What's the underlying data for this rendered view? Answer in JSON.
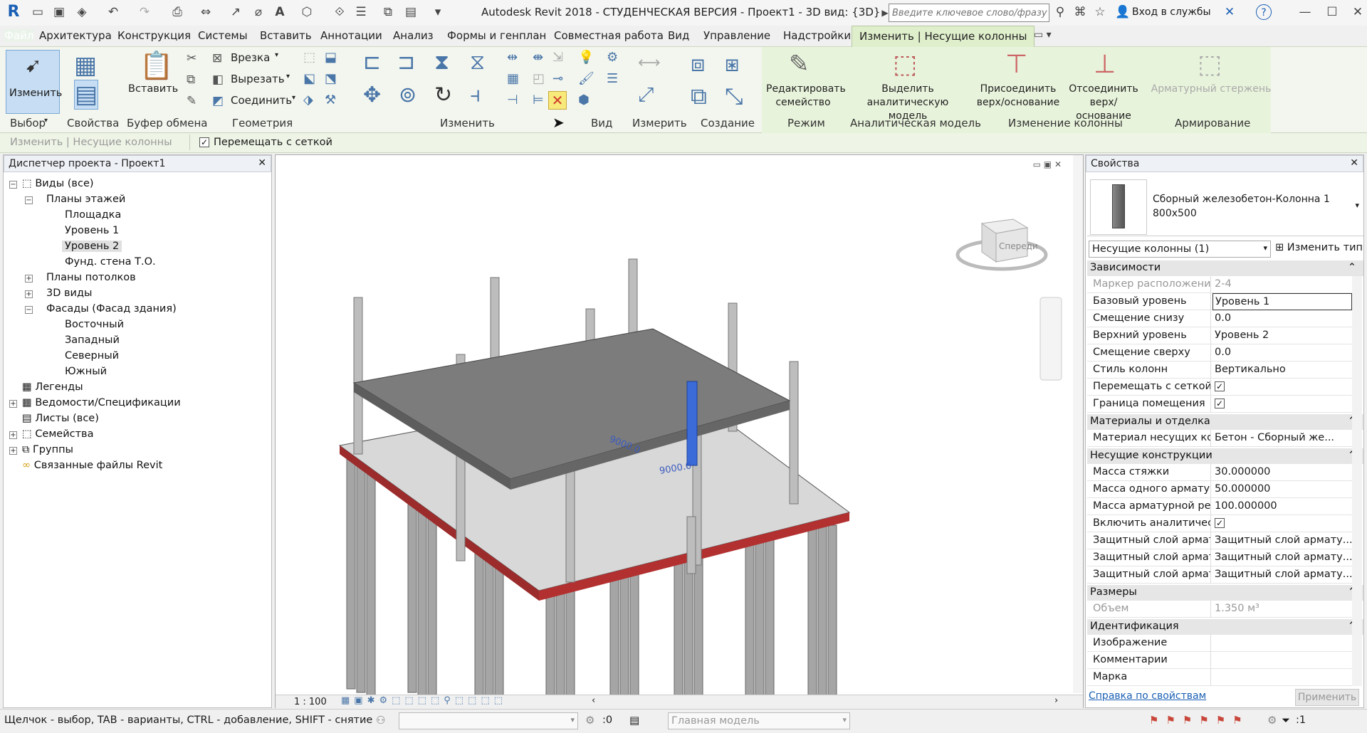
{
  "app": {
    "title": "Autodesk Revit 2018 - СТУДЕНЧЕСКАЯ ВЕРСИЯ -     Проект1 - 3D вид: {3D}",
    "search_placeholder": "Введите ключевое слово/фразу",
    "signin": "Вход в службы"
  },
  "tabs": [
    "Файл",
    "Архитектура",
    "Конструкция",
    "Системы",
    "Вставить",
    "Аннотации",
    "Анализ",
    "Формы и генплан",
    "Совместная работа",
    "Вид",
    "Управление",
    "Надстройки",
    "Изменить | Несущие колонны"
  ],
  "ribbon": {
    "modify": "Изменить",
    "paste": "Вставить",
    "cut_join": [
      "Врезка",
      "Вырезать",
      "Соединить"
    ],
    "edit_family": [
      "Редактировать",
      "семейство"
    ],
    "analytical": [
      "Выделить",
      "аналитическую модель"
    ],
    "attach": [
      "Присоединить",
      "верх/основание"
    ],
    "detach": [
      "Отсоединить",
      "верх/основание"
    ],
    "rebar": "Арматурный стержень",
    "groups": [
      "Выбор",
      "Свойства",
      "Буфер обмена",
      "Геометрия",
      "Изменить",
      "Вид",
      "Измерить",
      "Создание",
      "Режим",
      "Аналитическая модель",
      "Изменение колонны",
      "Армирование"
    ]
  },
  "optionsbar": {
    "context": "Изменить | Несущие колонны",
    "move_with_grid": "Перемещать с сеткой"
  },
  "browser": {
    "title": "Диспетчер проекта - Проект1",
    "nodes": [
      "Виды (все)",
      "Планы этажей",
      "Площадка",
      "Уровень 1",
      "Уровень 2",
      "Фунд. стена Т.О.",
      "Планы потолков",
      "3D виды",
      "Фасады (Фасад здания)",
      "Восточный",
      "Западный",
      "Северный",
      "Южный",
      "Легенды",
      "Ведомости/Спецификации",
      "Листы (все)",
      "Семейства",
      "Группы",
      "Связанные файлы Revit"
    ]
  },
  "viewport": {
    "dims": [
      "9000.0",
      "9000.0"
    ],
    "viewcube_face": "Спереди",
    "scale": "1 : 100"
  },
  "properties": {
    "title": "Свойства",
    "type_name": "Сборный железобетон-Колонна 1",
    "type_size": "800x500",
    "selector": "Несущие колонны (1)",
    "edit_type": "Изменить тип",
    "sections": [
      "Зависимости",
      "Материалы и отделка",
      "Несущие конструкции",
      "Размеры",
      "Идентификация"
    ],
    "rows_constraints": [
      [
        "Маркер расположени...",
        "2-4"
      ],
      [
        "Базовый уровень",
        "Уровень 1"
      ],
      [
        "Смещение снизу",
        "0.0"
      ],
      [
        "Верхний уровень",
        "Уровень 2"
      ],
      [
        "Смещение сверху",
        "0.0"
      ],
      [
        "Стиль колонн",
        "Вертикально"
      ],
      [
        "Перемещать с сеткой",
        "✓"
      ],
      [
        "Граница помещения",
        "✓"
      ]
    ],
    "rows_materials": [
      [
        "Материал несущих ко...",
        "Бетон - Сборный же..."
      ]
    ],
    "rows_structural": [
      [
        "Масса стяжки",
        "30.000000"
      ],
      [
        "Масса одного армату...",
        "50.000000"
      ],
      [
        "Масса арматурной ре...",
        "100.000000"
      ],
      [
        "Включить аналитичес...",
        "✓"
      ],
      [
        "Защитный слой армат...",
        "Защитный слой армату..."
      ],
      [
        "Защитный слой армат...",
        "Защитный слой армату..."
      ],
      [
        "Защитный слой армат...",
        "Защитный слой армату..."
      ]
    ],
    "rows_dimensions": [
      [
        "Объем",
        "1.350 м³"
      ]
    ],
    "rows_identity": [
      [
        "Изображение",
        ""
      ],
      [
        "Комментарии",
        ""
      ],
      [
        "Марка",
        ""
      ]
    ],
    "help_link": "Справка по свойствам",
    "apply": "Применить"
  },
  "status": {
    "hint": "Щелчок - выбор, TAB - варианты, CTRL - добавление, SHIFT - снятие выбор",
    "zero": ":0",
    "model": "Главная модель",
    "filter": ":1"
  }
}
